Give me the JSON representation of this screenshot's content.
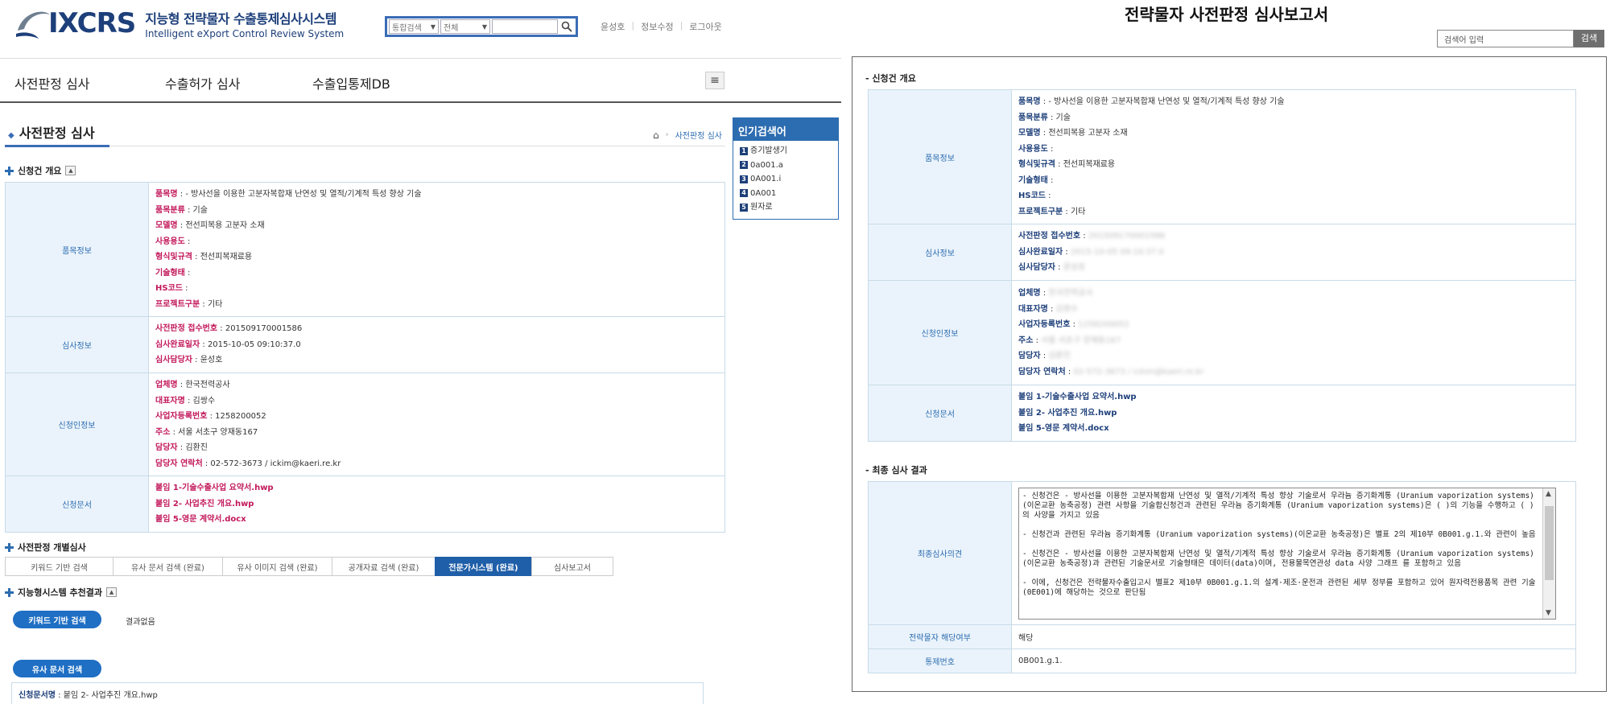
{
  "header": {
    "logo_word": "IXCRS",
    "title": "지능형 전략물자 수출통제심사시스템",
    "subtitle": "Intelligent eXport Control Review System",
    "search": {
      "type_select": "통합검색",
      "scope_select": "전체"
    },
    "user_links": [
      "윤성호",
      "정보수정",
      "로그아웃"
    ]
  },
  "nav": {
    "items": [
      "사전판정 심사",
      "수출허가 심사",
      "수출입통제DB"
    ]
  },
  "page": {
    "title": "사전판정 심사",
    "breadcrumb": "사전판정 심사"
  },
  "overview": {
    "heading": "신청건 개요",
    "item_info": {
      "label": "품목정보",
      "fields": [
        {
          "k": "품목명",
          "v": "- 방사선을 이용한 고분자복합재 난연성 및 열적/기계적 특성 향상 기술"
        },
        {
          "k": "품목분류",
          "v": "기술"
        },
        {
          "k": "모델명",
          "v": "전선피복용 고분자 소재"
        },
        {
          "k": "사용용도",
          "v": ""
        },
        {
          "k": "형식및규격",
          "v": "전선피복재료용"
        },
        {
          "k": "기술형태",
          "v": ""
        },
        {
          "k": "HS코드",
          "v": ""
        },
        {
          "k": "프로젝트구분",
          "v": "기타"
        }
      ]
    },
    "review_info": {
      "label": "심사정보",
      "fields": [
        {
          "k": "사전판정 접수번호",
          "v": "201509170001586"
        },
        {
          "k": "심사완료일자",
          "v": "2015-10-05 09:10:37.0"
        },
        {
          "k": "심사담당자",
          "v": "윤성호"
        }
      ]
    },
    "applicant_info": {
      "label": "신청인정보",
      "fields": [
        {
          "k": "업체명",
          "v": "한국전력공사"
        },
        {
          "k": "대표자명",
          "v": "김쌍수"
        },
        {
          "k": "사업자등록번호",
          "v": "1258200052"
        },
        {
          "k": "주소",
          "v": "서울 서초구 양재동167"
        },
        {
          "k": "담당자",
          "v": "김환진"
        },
        {
          "k": "담당자 연락처",
          "v": "02-572-3673 / ickim@kaeri.re.kr"
        }
      ]
    },
    "documents": {
      "label": "신청문서",
      "files": [
        "붙임 1-기술수출사업 요약서.hwp",
        "붙임 2- 사업추진 개요.hwp",
        "붙임 5-영문 계약서.docx"
      ]
    }
  },
  "hot_searches": {
    "title": "인기검색어",
    "items": [
      "증기발생기",
      "0a001.a",
      "0A001.i",
      "0A001",
      "원자로"
    ]
  },
  "individual_review": {
    "heading": "사전판정 개별심사",
    "tabs": [
      "키워드 기반 검색",
      "유사 문서 검색 (완료)",
      "유사 이미지 검색 (완료)",
      "공개자료 검색 (완료)",
      "전문가시스템 (완료)",
      "심사보고서"
    ]
  },
  "recommend": {
    "heading": "지능형시스템 추천결과",
    "keyword_btn": "키워드 기반 검색",
    "no_result": "결과없음",
    "similar_btn": "유사 문서 검색",
    "doc_label": "신청문서명",
    "doc_value": "붙임 2- 사업추진 개요.hwp"
  },
  "report": {
    "title": "전략물자 사전판정 심사보고서",
    "search_placeholder": "검색어 입력",
    "search_btn": "검색",
    "overview_heading": "- 신청건 개요",
    "review_fields": [
      {
        "k": "사전판정 접수번호",
        "v": "201509170001586"
      },
      {
        "k": "심사완료일자",
        "v": "2015-10-05 09:10:37.0"
      },
      {
        "k": "심사담당자",
        "v": "윤성호"
      }
    ],
    "applicant_fields": [
      {
        "k": "업체명",
        "v": "한국전력공사"
      },
      {
        "k": "대표자명",
        "v": "김쌍수"
      },
      {
        "k": "사업자등록번호",
        "v": "1258200052"
      },
      {
        "k": "주소",
        "v": "서울 서초구 양재동167"
      },
      {
        "k": "담당자",
        "v": "김환진"
      },
      {
        "k": "담당자 연락처",
        "v": "02-572-3673 / ickim@kaeri.re.kr"
      }
    ],
    "final_heading": "- 최종 심사 결과",
    "final_opinion_label": "최종심사의견",
    "final_opinion": "- 신청건은 - 방사선을 이용한 고분자복합재 난연성 및 열적/기계적 특성 향상 기술로서 우라늄 증기화계통 (Uranium vaporization systems)(이온교환 농축공정) 관련 사항을 기술합신청건과 관련된 우라늄 증기화계통 (Uranium vaporization systems)은 ( )의 기능을 수행하고 ( )의 사양을 가지고 있음\n\n- 신청건과 관련된 우라늄 증기화계통 (Uranium vaporization systems)(이온교환 농축공정)은 별표 2의 제10부 0B001.g.1.와 관련이 높음\n\n- 신청건은 - 방사선을 이용한 고분자복합재 난연성 및 열적/기계적 특성 향상 기술로서 우라늄 증기화계통 (Uranium vaporization systems)(이온교환 농축공정)과 관련된 기술문서로 기술형태은 데이터(data)이며, 전용물목연관성 data 사양 그래프 를 포함하고 있음\n\n- 이에, 신청건은 전략물자수출입고시 별표2 제10부 0B001.g.1.의 설계·제조·운전과 관련된 세부 정부를 포함하고 있어 원자력전용품목 관련 기술(0E001)에 해당하는 것으로 판단됨",
    "strategic_label": "전략물자 해당여부",
    "strategic_value": "해당",
    "control_label": "통제번호",
    "control_value": "0B001.g.1."
  },
  "colors": {
    "brand": "#1d3f7a",
    "accent": "#2c6cb0",
    "key_red": "#c2185b",
    "th_bg": "#eaf3fb"
  }
}
